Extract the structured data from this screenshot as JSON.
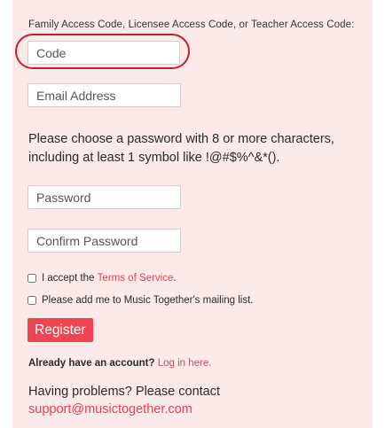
{
  "form": {
    "code_label": "Family Access Code, Licensee Access Code, or Teacher Access Code:",
    "code_placeholder": "Code",
    "email_placeholder": "Email Address",
    "password_instructions": "Please choose a password with 8 or more characters, including at least 1 symbol like !@#$%^&*().",
    "password_placeholder": "Password",
    "confirm_placeholder": "Confirm Password",
    "terms_prefix": "I accept the ",
    "terms_link": "Terms of Service",
    "terms_suffix": ".",
    "mailing_label": "Please add me to Music Together's mailing list.",
    "register_label": "Register"
  },
  "login": {
    "prompt": "Already have an account?",
    "link": "Log in here."
  },
  "support": {
    "text": "Having problems? Please contact",
    "email": "support@musictogether.com"
  },
  "colors": {
    "panel_bg": "#fce9e9",
    "accent": "#ef4553",
    "highlight": "#c2202f"
  }
}
